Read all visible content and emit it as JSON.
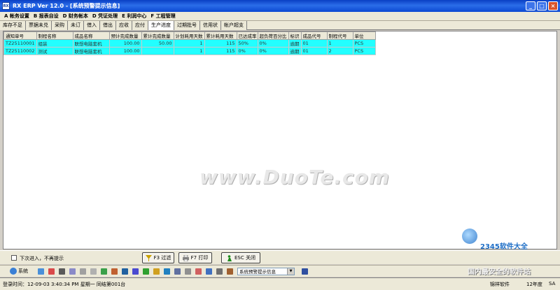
{
  "window": {
    "title": "RX ERP Ver 12.0 - [系统预警提示信息]",
    "icon": "RX"
  },
  "menu": [
    "A 帐务设置",
    "B 报表自设",
    "D 财务帐本",
    "D 凭证处理",
    "E 利润中心",
    "F 工程管理"
  ],
  "tabs": [
    {
      "label": "库存不足",
      "active": false
    },
    {
      "label": "票据未兑",
      "active": false
    },
    {
      "label": "采购",
      "active": false
    },
    {
      "label": "未订",
      "active": false
    },
    {
      "label": "借入",
      "active": false
    },
    {
      "label": "借出",
      "active": false
    },
    {
      "label": "应收",
      "active": false
    },
    {
      "label": "应付",
      "active": false
    },
    {
      "label": "生产进度",
      "active": true
    },
    {
      "label": "过期批号",
      "active": false
    },
    {
      "label": "信用状",
      "active": false
    },
    {
      "label": "帐户超支",
      "active": false
    }
  ],
  "grid": {
    "columns": [
      "通知单号",
      "制程名称",
      "成品名称",
      "预计完成数量",
      "累计完成数量",
      "计划耗用天数",
      "累计耗用天数",
      "已达成率",
      "超负荷百分比",
      "标识",
      "成品代号",
      "制程代号",
      "单位"
    ],
    "rows": [
      [
        "TZ25110001",
        "组装",
        "联想电脑套机",
        "100.00",
        "50.00",
        "1",
        "115",
        "50%",
        "0%",
        "逾期",
        "01",
        "1",
        "PCS"
      ],
      [
        "TZ25110002",
        "测试",
        "联想电脑套机",
        "100.00",
        "",
        "1",
        "115",
        "0%",
        "0%",
        "逾期",
        "01",
        "2",
        "PCS"
      ]
    ]
  },
  "watermark": "www.DuoTe.com",
  "bottom": {
    "checkbox_label": "下次进入，不再提示",
    "filter_button": "F3 过滤",
    "print_button": "F7 打印",
    "close_button": "ESC 关闭"
  },
  "toolbar": {
    "system_label": "系统",
    "select_value": "系统预警提示信息"
  },
  "status": {
    "login": "登录时间：12-09-03 3:40:34 PM  星期一  同结第001台",
    "vendor": "锦祥软件",
    "year": "12年度",
    "user": "SA"
  },
  "logos": {
    "brand": "2345软件大全",
    "slogan": "国内最安全的软件站"
  },
  "colors": {
    "row_highlight": "#22ffff",
    "title_bar": "#0a3fc4"
  }
}
